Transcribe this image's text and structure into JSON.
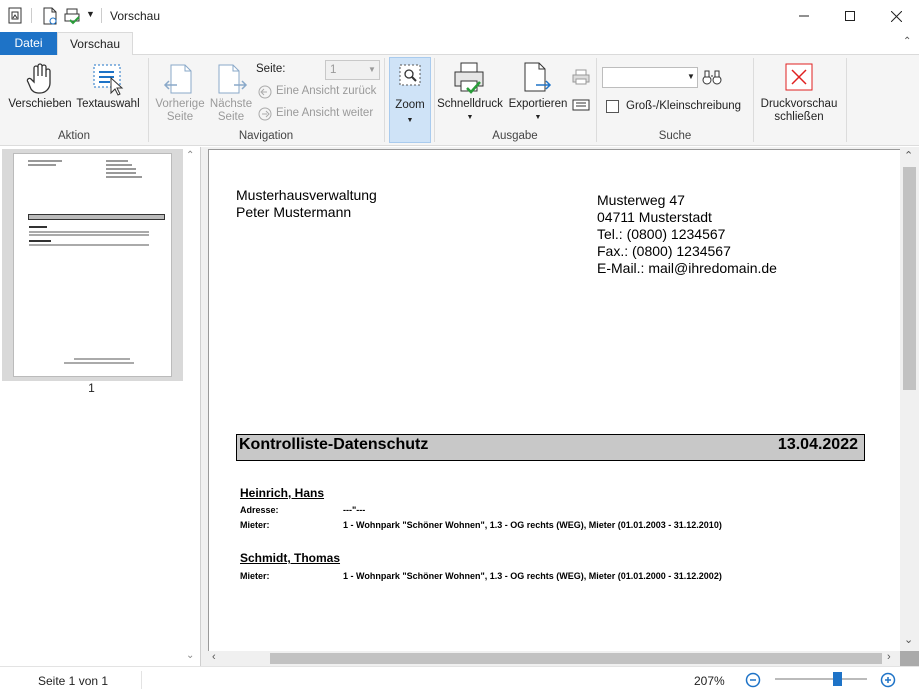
{
  "window": {
    "title": "Vorschau"
  },
  "tabs": [
    {
      "label": "Datei"
    },
    {
      "label": "Vorschau"
    }
  ],
  "ribbon": {
    "aktion": {
      "label": "Aktion",
      "verschieben": "Verschieben",
      "textauswahl": "Textauswahl"
    },
    "navigation": {
      "label": "Navigation",
      "vorherige_1": "Vorherige",
      "vorherige_2": "Seite",
      "naechste_1": "Nächste",
      "naechste_2": "Seite",
      "seite_label": "Seite:",
      "seite_value": "1",
      "zurueck": "Eine Ansicht zurück",
      "weiter": "Eine Ansicht weiter"
    },
    "zoom": {
      "label": "Zoom"
    },
    "ausgabe": {
      "label": "Ausgabe",
      "schnelldruck": "Schnelldruck",
      "exportieren": "Exportieren"
    },
    "suche": {
      "label": "Suche",
      "search_value": "",
      "case_label": "Groß-/Kleinschreibung"
    },
    "schliessen": {
      "line1": "Druckvorschau",
      "line2": "schließen"
    }
  },
  "thumbnail": {
    "page_number": "1"
  },
  "document": {
    "sender_1": "Musterhausverwaltung",
    "sender_2": "Peter Mustermann",
    "addr_1": "Musterweg 47",
    "addr_2": "04711 Musterstadt",
    "addr_3": "Tel.: (0800) 1234567",
    "addr_4": "Fax.: (0800) 1234567",
    "addr_5": "E-Mail.: mail@ihredomain.de",
    "heading": "Kontrolliste-Datenschutz",
    "date": "13.04.2022",
    "persons": [
      {
        "name": "Heinrich, Hans",
        "adresse_label": "Adresse:",
        "adresse_value": "---\"---",
        "mieter_label": "Mieter:",
        "mieter_value": "1 - Wohnpark \"Schöner Wohnen\", 1.3 - OG rechts (WEG), Mieter (01.01.2003 - 31.12.2010)"
      },
      {
        "name": "Schmidt, Thomas",
        "mieter_label": "Mieter:",
        "mieter_value": "1 - Wohnpark \"Schöner Wohnen\", 1.3 - OG rechts (WEG), Mieter (01.01.2000 - 31.12.2002)"
      }
    ]
  },
  "status": {
    "page_info": "Seite 1 von 1",
    "zoom": "207%",
    "zoom_level": 0.7
  },
  "colors": {
    "accent": "#1e73c7",
    "close_red": "#e02020",
    "selected": "#cfe3f7"
  }
}
